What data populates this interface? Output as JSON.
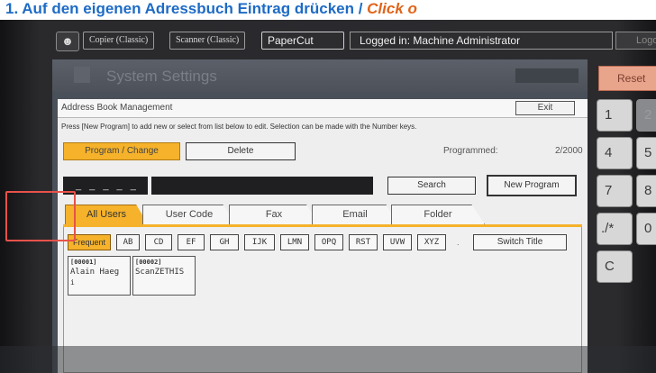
{
  "banner": {
    "text": "1. Auf den eigenen Adressbuch Eintrag drücken / ",
    "highlight": "Click o"
  },
  "topbar": {
    "user_icon": "user-icon",
    "copier": "Copier (Classic)",
    "scanner": "Scanner (Classic)",
    "papercut": "PaperCut",
    "logged_in": "Logged in: Machine Administrator",
    "logout": "Logo"
  },
  "screen": {
    "title": "System Settings",
    "section": "Address Book Management",
    "exit": "Exit",
    "hint": "Press [New Program] to add new or select from list below to edit. Selection can be made with the Number keys.",
    "program_change": "Program / Change",
    "delete": "Delete",
    "programmed_label": "Programmed:",
    "programmed_value": "2/2000",
    "search_placeholder": "_ _ _ _ _",
    "search": "Search",
    "new_program": "New Program",
    "tabs": [
      "All Users",
      "User Code",
      "Fax",
      "Email",
      "Folder"
    ],
    "alpha": [
      "Frequent",
      "AB",
      "CD",
      "EF",
      "GH",
      "IJK",
      "LMN",
      "OPQ",
      "RST",
      "UVW",
      "XYZ"
    ],
    "dot": ".",
    "switch_title": "Switch Title",
    "entries": [
      {
        "num": "[00001]",
        "name": "Alain Haeg",
        "cursor": "i"
      },
      {
        "num": "[00002]",
        "name": "ScanZETHIS"
      }
    ]
  },
  "keypad": {
    "reset": "Reset",
    "keys": [
      "1",
      "2",
      "4",
      "5",
      "7",
      "8",
      "./*",
      "0",
      "C"
    ]
  },
  "colors": {
    "accent": "#f5b22a",
    "selection": "#e8524a",
    "banner_blue": "#1e6bc6",
    "banner_orange": "#e0641a"
  }
}
